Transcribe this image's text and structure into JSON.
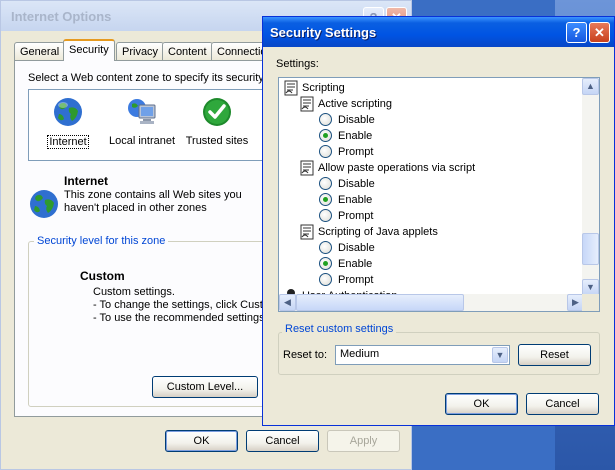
{
  "internet_options": {
    "title": "Internet Options",
    "help_glyph": "?",
    "close_glyph": "✕",
    "tabs": [
      {
        "label": "General"
      },
      {
        "label": "Security"
      },
      {
        "label": "Privacy"
      },
      {
        "label": "Content"
      },
      {
        "label": "Connectio"
      }
    ],
    "zone_intro": "Select a Web content zone to specify its security s",
    "zones": [
      {
        "label": "Internet",
        "icon": "globe-icon"
      },
      {
        "label": "Local intranet",
        "icon": "computer-icon"
      },
      {
        "label": "Trusted sites",
        "icon": "checkmark-icon"
      }
    ],
    "zone_title": "Internet",
    "zone_description": "This zone contains all Web sites you haven't placed in other zones",
    "security_group_label": "Security level for this zone",
    "custom_title": "Custom",
    "custom_lines": [
      "Custom settings.",
      "- To change the settings, click Custo",
      "- To use the recommended settings,"
    ],
    "custom_level_button": "Custom Level...",
    "ok_button": "OK",
    "cancel_button": "Cancel",
    "apply_button": "Apply"
  },
  "security_settings": {
    "title": "Security Settings",
    "help_glyph": "?",
    "close_glyph": "✕",
    "settings_label": "Settings:",
    "tree": [
      {
        "type": "category",
        "label": "Scripting"
      },
      {
        "type": "setting",
        "label": "Active scripting"
      },
      {
        "type": "option",
        "label": "Disable",
        "selected": false
      },
      {
        "type": "option",
        "label": "Enable",
        "selected": true
      },
      {
        "type": "option",
        "label": "Prompt",
        "selected": false
      },
      {
        "type": "setting",
        "label": "Allow paste operations via script"
      },
      {
        "type": "option",
        "label": "Disable",
        "selected": false
      },
      {
        "type": "option",
        "label": "Enable",
        "selected": true
      },
      {
        "type": "option",
        "label": "Prompt",
        "selected": false
      },
      {
        "type": "setting",
        "label": "Scripting of Java applets"
      },
      {
        "type": "option",
        "label": "Disable",
        "selected": false
      },
      {
        "type": "option",
        "label": "Enable",
        "selected": true
      },
      {
        "type": "option",
        "label": "Prompt",
        "selected": false
      },
      {
        "type": "category",
        "label": "User Authentication"
      }
    ],
    "reset_group_label": "Reset custom settings",
    "reset_to_label": "Reset to:",
    "reset_level": "Medium",
    "reset_button": "Reset",
    "ok_button": "OK",
    "cancel_button": "Cancel"
  }
}
